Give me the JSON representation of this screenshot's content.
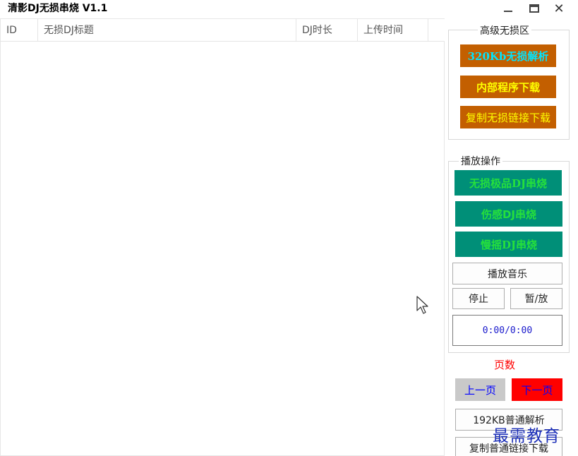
{
  "app": {
    "title": "清影DJ无损串烧 V1.1",
    "window_controls": [
      "minimize-icon",
      "maximize-icon",
      "close-icon"
    ]
  },
  "table": {
    "columns": [
      "ID",
      "无损DJ标题",
      "DJ时长",
      "上传时间"
    ],
    "rows": []
  },
  "advanced_group": {
    "title": "高级无损区",
    "buttons": [
      {
        "label": "320Kb无损解析",
        "text_color": "#00e5ff"
      },
      {
        "label": "内部程序下载",
        "text_color": "#ffff00"
      },
      {
        "label": "复制无损链接下载",
        "text_color": "#ffff00"
      }
    ],
    "button_bg": "#c35f00"
  },
  "play_group": {
    "title": "播放操作",
    "category_buttons": [
      "无损极品DJ串烧",
      "伤感DJ串烧",
      "慢摇DJ串烧"
    ],
    "category_bg": "#008f78",
    "category_text_color": "#25e03c",
    "play_music": "播放音乐",
    "stop": "停止",
    "pause_play": "暂/放",
    "time_display": "0:00/0:00"
  },
  "pagination": {
    "label": "页数",
    "prev": "上一页",
    "next": "下一页",
    "label_color": "#ff0000",
    "prev_bg": "#c9c9c9",
    "next_bg": "#ff0000",
    "button_text_color": "#0000ff"
  },
  "bottom_buttons": {
    "parse_192": "192KB普通解析",
    "copy_normal_link": "复制普通链接下载"
  },
  "watermark": "最需教育"
}
